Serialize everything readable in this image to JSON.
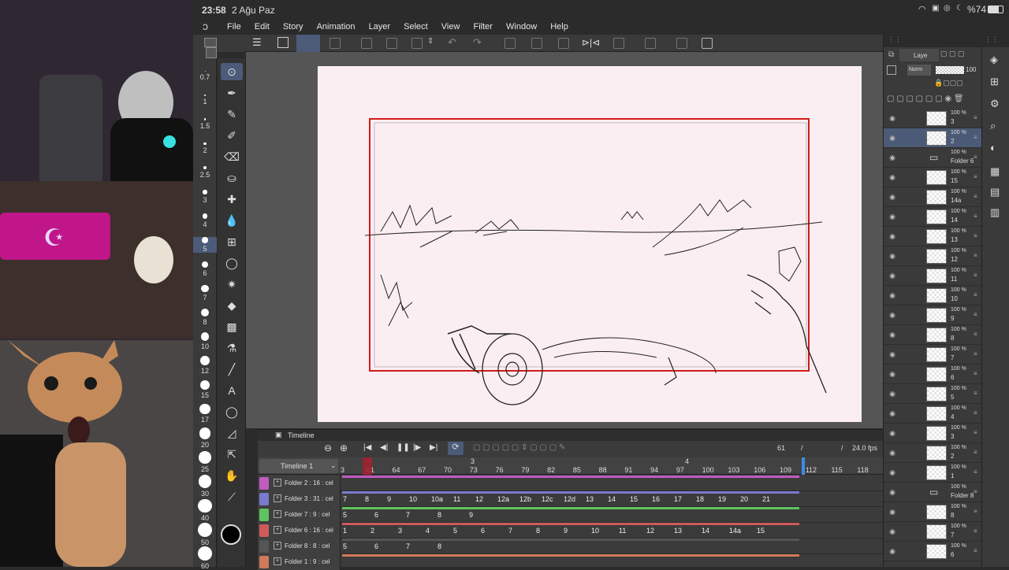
{
  "status": {
    "time": "23:58",
    "date": "2 Ağu Paz",
    "battery": "%74"
  },
  "menu": [
    "File",
    "Edit",
    "Story",
    "Animation",
    "Layer",
    "Select",
    "View",
    "Filter",
    "Window",
    "Help"
  ],
  "brush_sizes": [
    "0.7",
    "1",
    "1.5",
    "2",
    "2.5",
    "3",
    "4",
    "5",
    "6",
    "7",
    "8",
    "10",
    "12",
    "15",
    "17",
    "20",
    "25",
    "30",
    "40",
    "50",
    "60"
  ],
  "tools": [
    "pointer-icon",
    "pen-icon",
    "pencil-icon",
    "brush-icon",
    "eraser-icon",
    "blend-icon",
    "fill-icon",
    "water-icon",
    "frame-icon",
    "lasso-icon",
    "wand-icon",
    "bucket-icon",
    "gradient-icon",
    "eyedropper-icon",
    "line-icon",
    "text-icon",
    "balloon-icon",
    "ruler-icon",
    "move-icon",
    "hand-icon",
    "picker-icon"
  ],
  "timeline": {
    "tab": "Timeline",
    "name": "Timeline 1",
    "current_frame": "61",
    "fps": "24.0 fps",
    "separator": "/",
    "ruler": [
      "3",
      "61",
      "64",
      "67",
      "70",
      "73",
      "76",
      "79",
      "82",
      "85",
      "88",
      "91",
      "94",
      "97",
      "100",
      "103",
      "106",
      "109",
      "112",
      "115",
      "118"
    ],
    "markers": [
      "3",
      "4"
    ],
    "tracks": [
      {
        "name": "Folder 2 : 16 : cel",
        "color": "#c05bc0",
        "frames": []
      },
      {
        "name": "Folder 3 : 31 : cel",
        "color": "#7a7ad0",
        "frames": [
          "7",
          "8",
          "9",
          "10",
          "10a",
          "11",
          "12",
          "12a",
          "12b",
          "12c",
          "12d",
          "13",
          "14",
          "15",
          "16",
          "17",
          "18",
          "19",
          "20",
          "21"
        ]
      },
      {
        "name": "Folder 7 : 9 : cel",
        "color": "#5fc45f",
        "frames": [
          "5",
          "6",
          "7",
          "8",
          "9"
        ]
      },
      {
        "name": "Folder 6 : 16 : cel",
        "color": "#d05a5a",
        "frames": [
          "1",
          "2",
          "3",
          "4",
          "5",
          "6",
          "7",
          "8",
          "9",
          "10",
          "11",
          "12",
          "13",
          "14",
          "14a",
          "15"
        ]
      },
      {
        "name": "Folder 8 : 8 : cel",
        "color": "#555555",
        "frames": [
          "5",
          "6",
          "7",
          "8"
        ]
      },
      {
        "name": "Folder 1 : 9 : cel",
        "color": "#d07a5a",
        "frames": []
      }
    ]
  },
  "layer_panel": {
    "title": "Laye",
    "blend_mode": "Norm",
    "opacity": "100",
    "layers": [
      {
        "pct": "100 %",
        "name": "3",
        "selected": false
      },
      {
        "pct": "100 %",
        "name": "2",
        "selected": true
      },
      {
        "pct": "100 %",
        "name": "Folder 6",
        "selected": false,
        "folder": true
      },
      {
        "pct": "100 %",
        "name": "15",
        "selected": false
      },
      {
        "pct": "100 %",
        "name": "14a",
        "selected": false
      },
      {
        "pct": "100 %",
        "name": "14",
        "selected": false
      },
      {
        "pct": "100 %",
        "name": "13",
        "selected": false
      },
      {
        "pct": "100 %",
        "name": "12",
        "selected": false
      },
      {
        "pct": "100 %",
        "name": "11",
        "selected": false
      },
      {
        "pct": "100 %",
        "name": "10",
        "selected": false
      },
      {
        "pct": "100 %",
        "name": "9",
        "selected": false
      },
      {
        "pct": "100 %",
        "name": "8",
        "selected": false
      },
      {
        "pct": "100 %",
        "name": "7",
        "selected": false
      },
      {
        "pct": "100 %",
        "name": "6",
        "selected": false
      },
      {
        "pct": "100 %",
        "name": "5",
        "selected": false
      },
      {
        "pct": "100 %",
        "name": "4",
        "selected": false
      },
      {
        "pct": "100 %",
        "name": "3",
        "selected": false
      },
      {
        "pct": "100 %",
        "name": "2",
        "selected": false
      },
      {
        "pct": "100 %",
        "name": "1",
        "selected": false
      },
      {
        "pct": "100 %",
        "name": "Folder 8",
        "selected": false,
        "folder": true
      },
      {
        "pct": "100 %",
        "name": "8",
        "selected": false
      },
      {
        "pct": "100 %",
        "name": "7",
        "selected": false
      },
      {
        "pct": "100 %",
        "name": "6",
        "selected": false
      }
    ]
  }
}
